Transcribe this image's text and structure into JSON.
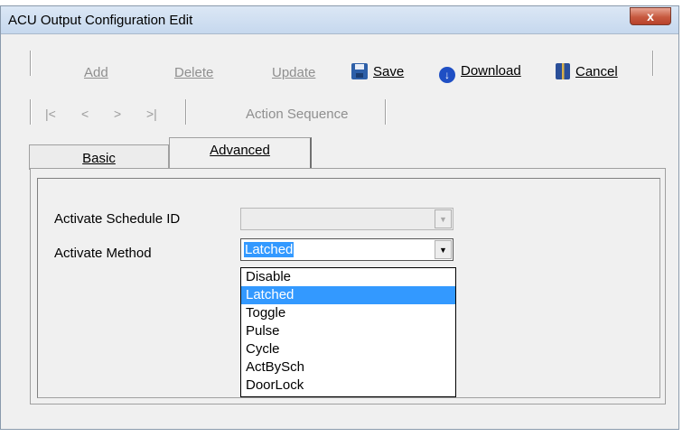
{
  "window": {
    "title": "ACU Output Configuration Edit",
    "close_label": "x"
  },
  "toolbar": {
    "add": {
      "label": "Add",
      "enabled": false
    },
    "delete": {
      "label": "Delete",
      "enabled": false
    },
    "update": {
      "label": "Update",
      "enabled": false
    },
    "save": {
      "label": "Save",
      "icon": "save-icon"
    },
    "download": {
      "label": "Download",
      "icon": "download-icon"
    },
    "cancel": {
      "label": "Cancel",
      "icon": "cancel-icon"
    },
    "nav": {
      "first": "|<",
      "prev": "<",
      "next": ">",
      "last": ">|"
    },
    "action_sequence": {
      "label": "Action Sequence",
      "enabled": false
    }
  },
  "tabs": [
    {
      "label": "Basic",
      "active": false
    },
    {
      "label": "Advanced",
      "active": true
    }
  ],
  "form": {
    "schedule_label": "Activate Schedule ID",
    "schedule_value": "",
    "method_label": "Activate Method",
    "method_value": "Latched",
    "method_options": [
      "Disable",
      "Latched",
      "Toggle",
      "Pulse",
      "Cycle",
      "ActBySch",
      "DoorLock"
    ],
    "selected_option": "Latched"
  },
  "colors": {
    "selection": "#3399ff",
    "titlebar": "#c6d8ee"
  }
}
